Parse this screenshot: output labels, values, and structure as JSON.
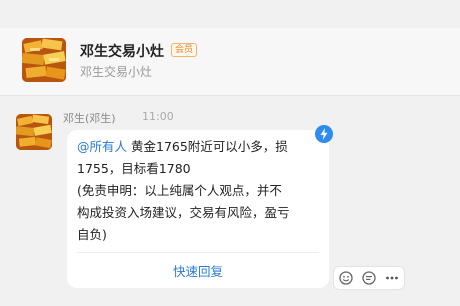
{
  "header": {
    "group_name": "邓生交易小灶",
    "member_badge": "会员",
    "subtitle": "邓生交易小灶",
    "avatar_icon": "gold-bars-avatar"
  },
  "message": {
    "sender": "邓生(邓生)",
    "time": "11:00",
    "avatar_icon": "gold-bars-avatar",
    "mention": "@所有人",
    "lines": [
      " 黄金1765附近可以小多，损",
      "1755，目标看1780",
      "(免责申明：以上纯属个人观点，并不",
      "构成投资入场建议，交易有风险，盈亏",
      "自负)"
    ],
    "quick_reply": "快速回复",
    "flash_icon": "flash-icon"
  },
  "actions": {
    "icons": [
      "emoji-icon",
      "comment-icon",
      "more-icon"
    ]
  },
  "colors": {
    "accent": "#2a7bd6",
    "badge": "#e08a2c",
    "background": "#f1f1f1"
  }
}
